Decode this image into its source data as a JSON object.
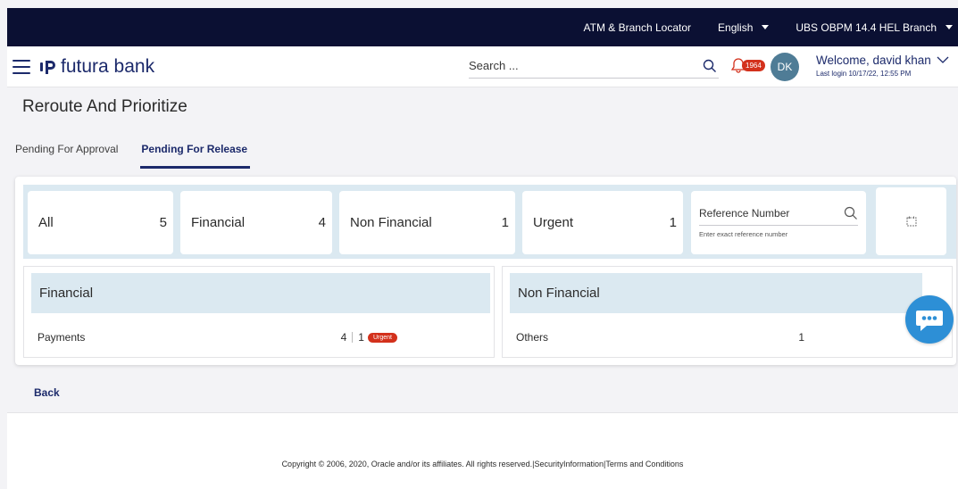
{
  "topbar": {
    "locator": "ATM & Branch Locator",
    "language": "English",
    "branch": "UBS OBPM 14.4 HEL Branch"
  },
  "header": {
    "brand": "futura bank",
    "search_placeholder": "Search ...",
    "notification_count": "1964",
    "avatar_initials": "DK",
    "welcome": "Welcome, david khan",
    "last_login": "Last login 10/17/22, 12:55 PM"
  },
  "page": {
    "title": "Reroute And Prioritize"
  },
  "tabs": [
    {
      "label": "Pending For Approval",
      "active": false
    },
    {
      "label": "Pending For Release",
      "active": true
    }
  ],
  "summary": {
    "cards": [
      {
        "label": "All",
        "count": "5"
      },
      {
        "label": "Financial",
        "count": "4"
      },
      {
        "label": "Non Financial",
        "count": "1"
      },
      {
        "label": "Urgent",
        "count": "1"
      }
    ],
    "reference_placeholder": "Reference Number",
    "reference_hint": "Enter exact reference number"
  },
  "sections": {
    "financial": {
      "title": "Financial",
      "row_label": "Payments",
      "row_count": "4",
      "urgent_count": "1",
      "urgent_badge": "Urgent"
    },
    "non_financial": {
      "title": "Non Financial",
      "row_label": "Others",
      "row_count": "1"
    }
  },
  "back_label": "Back",
  "footer": {
    "text": "Copyright © 2006, 2020, Oracle and/or its affiliates. All rights reserved.|SecurityInformation|Terms and Conditions"
  },
  "colors": {
    "navy": "#0b1033",
    "brand_blue": "#1c2a6b",
    "light_blue": "#dbe9f1",
    "urgent_red": "#d3311c",
    "chat_blue": "#2d8fd6"
  }
}
